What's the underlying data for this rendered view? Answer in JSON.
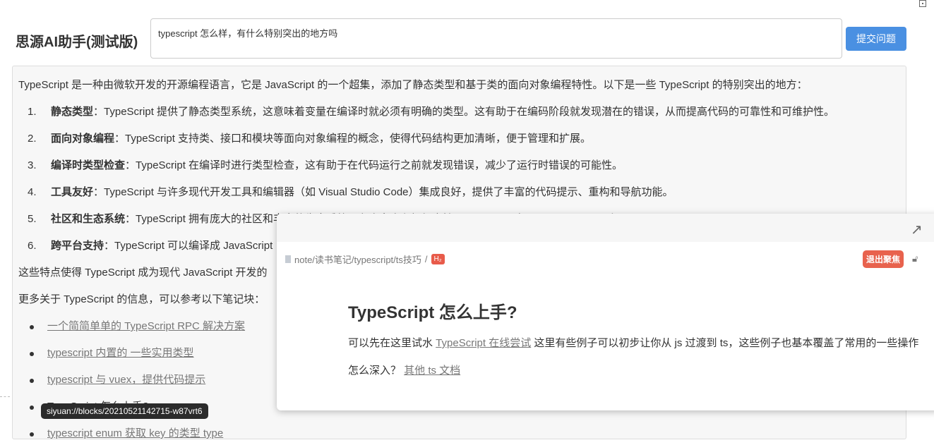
{
  "app": {
    "title": "思源AI助手(测试版)",
    "question": "typescript 怎么样，有什么特别突出的地方吗",
    "submit_label": "提交问题"
  },
  "answer": {
    "intro": "TypeScript 是一种由微软开发的开源编程语言，它是 JavaScript 的一个超集，添加了静态类型和基于类的面向对象编程特性。以下是一些 TypeScript 的特别突出的地方：",
    "items": [
      {
        "num": "1.",
        "term": "静态类型",
        "text": "：TypeScript 提供了静态类型系统，这意味着变量在编译时就必须有明确的类型。这有助于在编码阶段就发现潜在的错误，从而提高代码的可靠性和可维护性。"
      },
      {
        "num": "2.",
        "term": "面向对象编程",
        "text": "：TypeScript 支持类、接口和模块等面向对象编程的概念，使得代码结构更加清晰，便于管理和扩展。"
      },
      {
        "num": "3.",
        "term": "编译时类型检查",
        "text": "：TypeScript 在编译时进行类型检查，这有助于在代码运行之前就发现错误，减少了运行时错误的可能性。"
      },
      {
        "num": "4.",
        "term": "工具友好",
        "text": "：TypeScript 与许多现代开发工具和编辑器（如 Visual Studio Code）集成良好，提供了丰富的代码提示、重构和导航功能。"
      },
      {
        "num": "5.",
        "term": "社区和生态系统",
        "text": "：TypeScript 拥有庞大的社区和丰富的生态系统，有许多库和框架支持 TypeScript，如 Angular、React 和 Vue.js。"
      },
      {
        "num": "6.",
        "term": "跨平台支持",
        "text": "：TypeScript 可以编译成 JavaScript"
      }
    ],
    "summary": "这些特点使得 TypeScript 成为现代 JavaScript 开发的",
    "more": "更多关于 TypeScript 的信息，可以参考以下笔记块：",
    "links": [
      "一个简简单单的 TypeScript RPC 解决方案",
      "typescript 内置的 一些实用类型",
      "typescript 与 vuex，提供代码提示",
      "TypeScript 怎么上手?",
      "typescript enum 获取 key 的类型 type"
    ]
  },
  "tooltip": "siyuan://blocks/20210521142715-w87vrt6",
  "popup": {
    "breadcrumb": "note/读书笔记/typescript/ts技巧",
    "separator": "/",
    "heading_badge": "H₂",
    "exit_focus": "退出聚焦",
    "heading": "TypeScript 怎么上手?",
    "p1_before": "可以先在这里试水 ",
    "p1_link": "TypeScript 在线尝试",
    "p1_after": " 这里有些例子可以初步让你从 js 过渡到 ts，这些例子也基本覆盖了常用的一些操作",
    "p2_before": "怎么深入？ ",
    "p2_link": "其他 ts 文档"
  }
}
